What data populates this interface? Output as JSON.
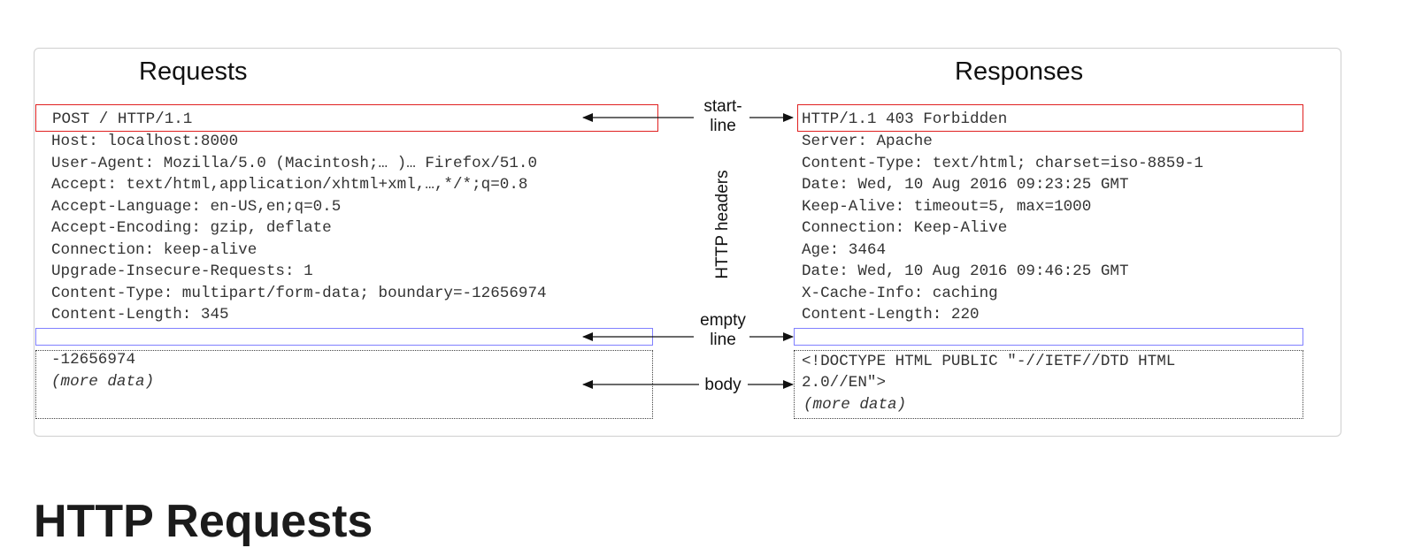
{
  "diagram": {
    "requests_title": "Requests",
    "responses_title": "Responses",
    "request": {
      "start_line": "POST / HTTP/1.1",
      "headers": [
        "Host: localhost:8000",
        "User-Agent: Mozilla/5.0 (Macintosh;… )… Firefox/51.0",
        "Accept: text/html,application/xhtml+xml,…,*/*;q=0.8",
        "Accept-Language: en-US,en;q=0.5",
        "Accept-Encoding: gzip, deflate",
        "Connection: keep-alive",
        "Upgrade-Insecure-Requests: 1",
        "Content-Type: multipart/form-data; boundary=-12656974",
        "Content-Length: 345"
      ],
      "body": [
        "-12656974",
        "(more data)"
      ]
    },
    "response": {
      "start_line": "HTTP/1.1 403 Forbidden",
      "headers": [
        "Server: Apache",
        "Content-Type: text/html; charset=iso-8859-1",
        "Date: Wed, 10 Aug 2016 09:23:25 GMT",
        "Keep-Alive: timeout=5, max=1000",
        "Connection: Keep-Alive",
        "Age: 3464",
        "Date: Wed, 10 Aug 2016 09:46:25 GMT",
        "X-Cache-Info: caching",
        "Content-Length: 220"
      ],
      "body": [
        "<!DOCTYPE HTML PUBLIC \"-//IETF//DTD HTML",
        "2.0//EN\">",
        "(more data)"
      ]
    },
    "labels": {
      "start_line": [
        "start-",
        "line"
      ],
      "http_headers": "HTTP headers",
      "empty_line": [
        "empty",
        "line"
      ],
      "body": "body"
    },
    "colors": {
      "start_line_box": "#e02020",
      "empty_line_box": "#8080ff",
      "body_box": "#444444"
    }
  },
  "page": {
    "heading": "HTTP Requests"
  }
}
